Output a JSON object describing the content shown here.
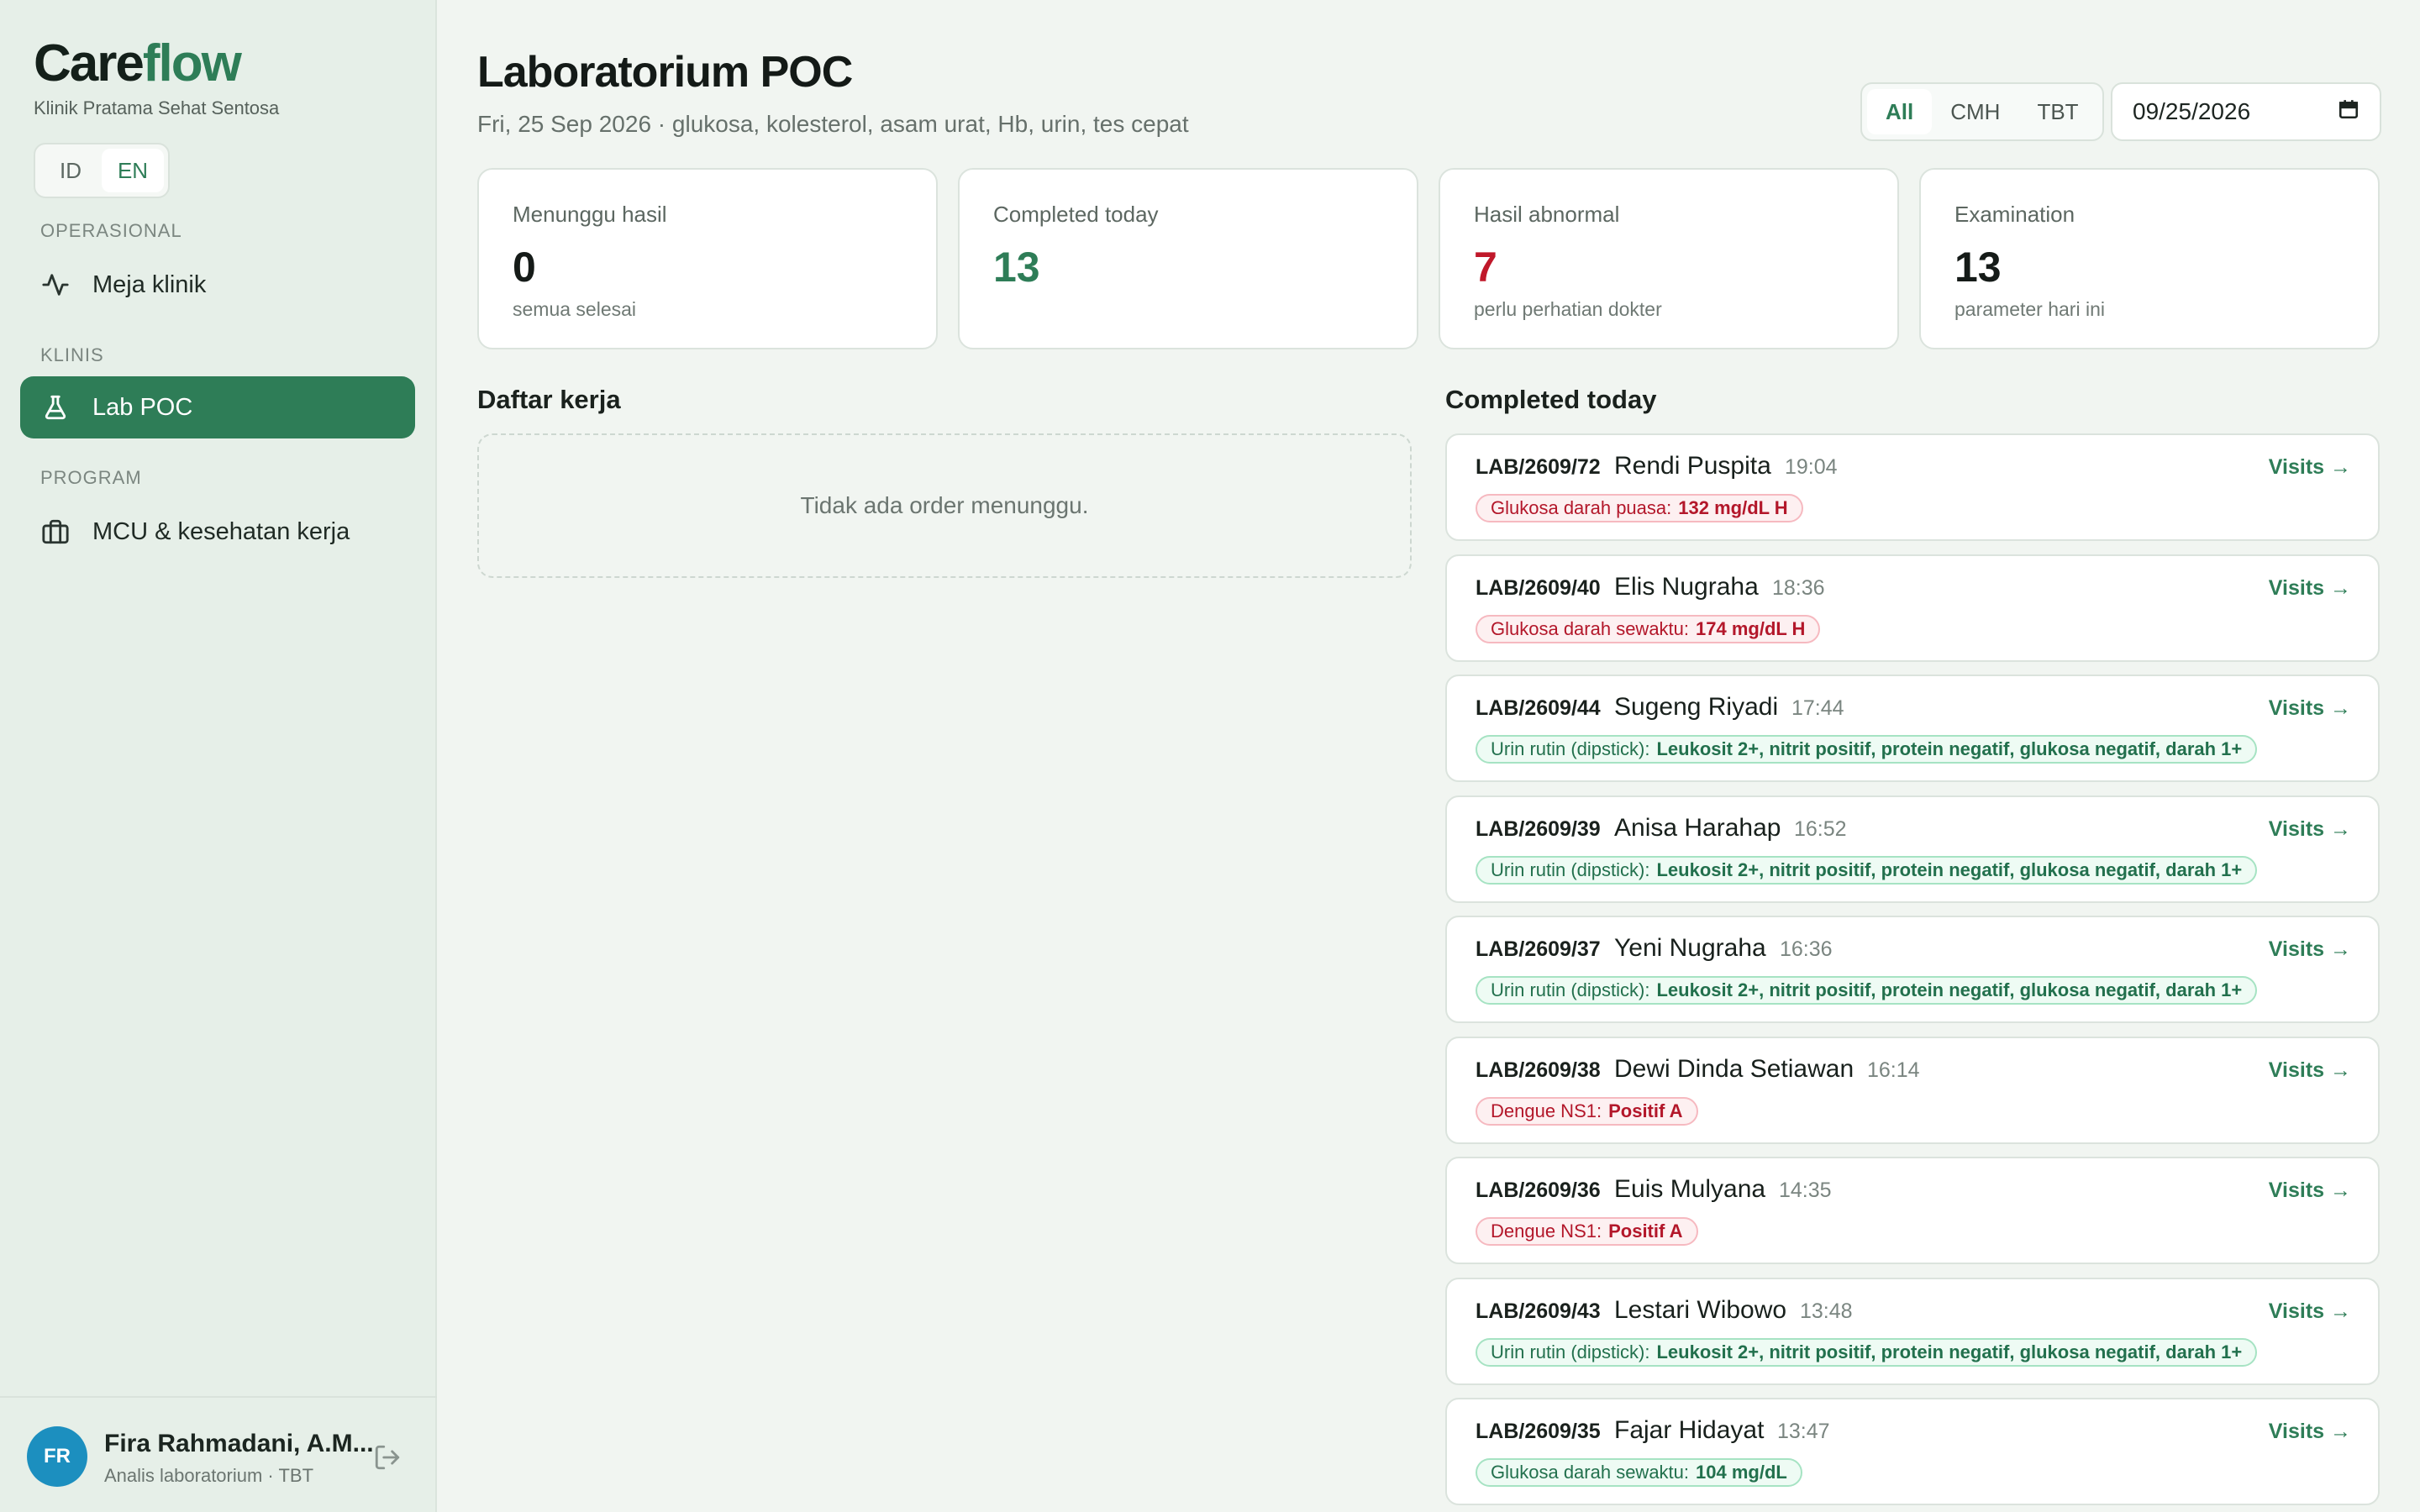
{
  "brand": {
    "part1": "Care",
    "part2": "flow",
    "clinic": "Klinik Pratama Sehat Sentosa"
  },
  "lang": {
    "id": "ID",
    "en": "EN"
  },
  "nav": {
    "operasional": "OPERASIONAL",
    "meja_klinik": "Meja klinik",
    "klinis": "KLINIS",
    "lab_poc": "Lab POC",
    "program": "PROGRAM",
    "mcu": "MCU & kesehatan kerja"
  },
  "user": {
    "initials": "FR",
    "name": "Fira Rahmadani, A.M...",
    "role": "Analis laboratorium · TBT"
  },
  "header": {
    "title": "Laboratorium POC",
    "subtitle": "Fri, 25 Sep 2026 · glukosa, kolesterol, asam urat, Hb, urin, tes cepat",
    "filters": [
      "All",
      "CMH",
      "TBT"
    ],
    "date": "09/25/2026"
  },
  "stats": [
    {
      "label": "Menunggu hasil",
      "value": "0",
      "hint": "semua selesai",
      "tone": "default"
    },
    {
      "label": "Completed today",
      "value": "13",
      "hint": "",
      "tone": "green"
    },
    {
      "label": "Hasil abnormal",
      "value": "7",
      "hint": "perlu perhatian dokter",
      "tone": "red"
    },
    {
      "label": "Examination",
      "value": "13",
      "hint": "parameter hari ini",
      "tone": "default"
    }
  ],
  "worklist": {
    "title": "Daftar kerja",
    "empty": "Tidak ada order menunggu."
  },
  "completed": {
    "title": "Completed today",
    "visits_label": "Visits →",
    "items": [
      {
        "code": "LAB/2609/72",
        "name": "Rendi Puspita",
        "time": "19:04",
        "test": "Glukosa darah puasa:",
        "value": "132 mg/dL  H",
        "tone": "red"
      },
      {
        "code": "LAB/2609/40",
        "name": "Elis Nugraha",
        "time": "18:36",
        "test": "Glukosa darah sewaktu:",
        "value": "174 mg/dL  H",
        "tone": "red"
      },
      {
        "code": "LAB/2609/44",
        "name": "Sugeng Riyadi",
        "time": "17:44",
        "test": "Urin rutin (dipstick):",
        "value": "Leukosit 2+, nitrit positif, protein negatif, glukosa negatif, darah 1+",
        "tone": "green"
      },
      {
        "code": "LAB/2609/39",
        "name": "Anisa Harahap",
        "time": "16:52",
        "test": "Urin rutin (dipstick):",
        "value": "Leukosit 2+, nitrit positif, protein negatif, glukosa negatif, darah 1+",
        "tone": "green"
      },
      {
        "code": "LAB/2609/37",
        "name": "Yeni Nugraha",
        "time": "16:36",
        "test": "Urin rutin (dipstick):",
        "value": "Leukosit 2+, nitrit positif, protein negatif, glukosa negatif, darah 1+",
        "tone": "green"
      },
      {
        "code": "LAB/2609/38",
        "name": "Dewi Dinda Setiawan",
        "time": "16:14",
        "test": "Dengue NS1:",
        "value": "Positif  A",
        "tone": "red"
      },
      {
        "code": "LAB/2609/36",
        "name": "Euis Mulyana",
        "time": "14:35",
        "test": "Dengue NS1:",
        "value": "Positif  A",
        "tone": "red"
      },
      {
        "code": "LAB/2609/43",
        "name": "Lestari Wibowo",
        "time": "13:48",
        "test": "Urin rutin (dipstick):",
        "value": "Leukosit 2+, nitrit positif, protein negatif, glukosa negatif, darah 1+",
        "tone": "green"
      },
      {
        "code": "LAB/2609/35",
        "name": "Fajar Hidayat",
        "time": "13:47",
        "test": "Glukosa darah sewaktu:",
        "value": "104 mg/dL",
        "tone": "green"
      }
    ]
  }
}
